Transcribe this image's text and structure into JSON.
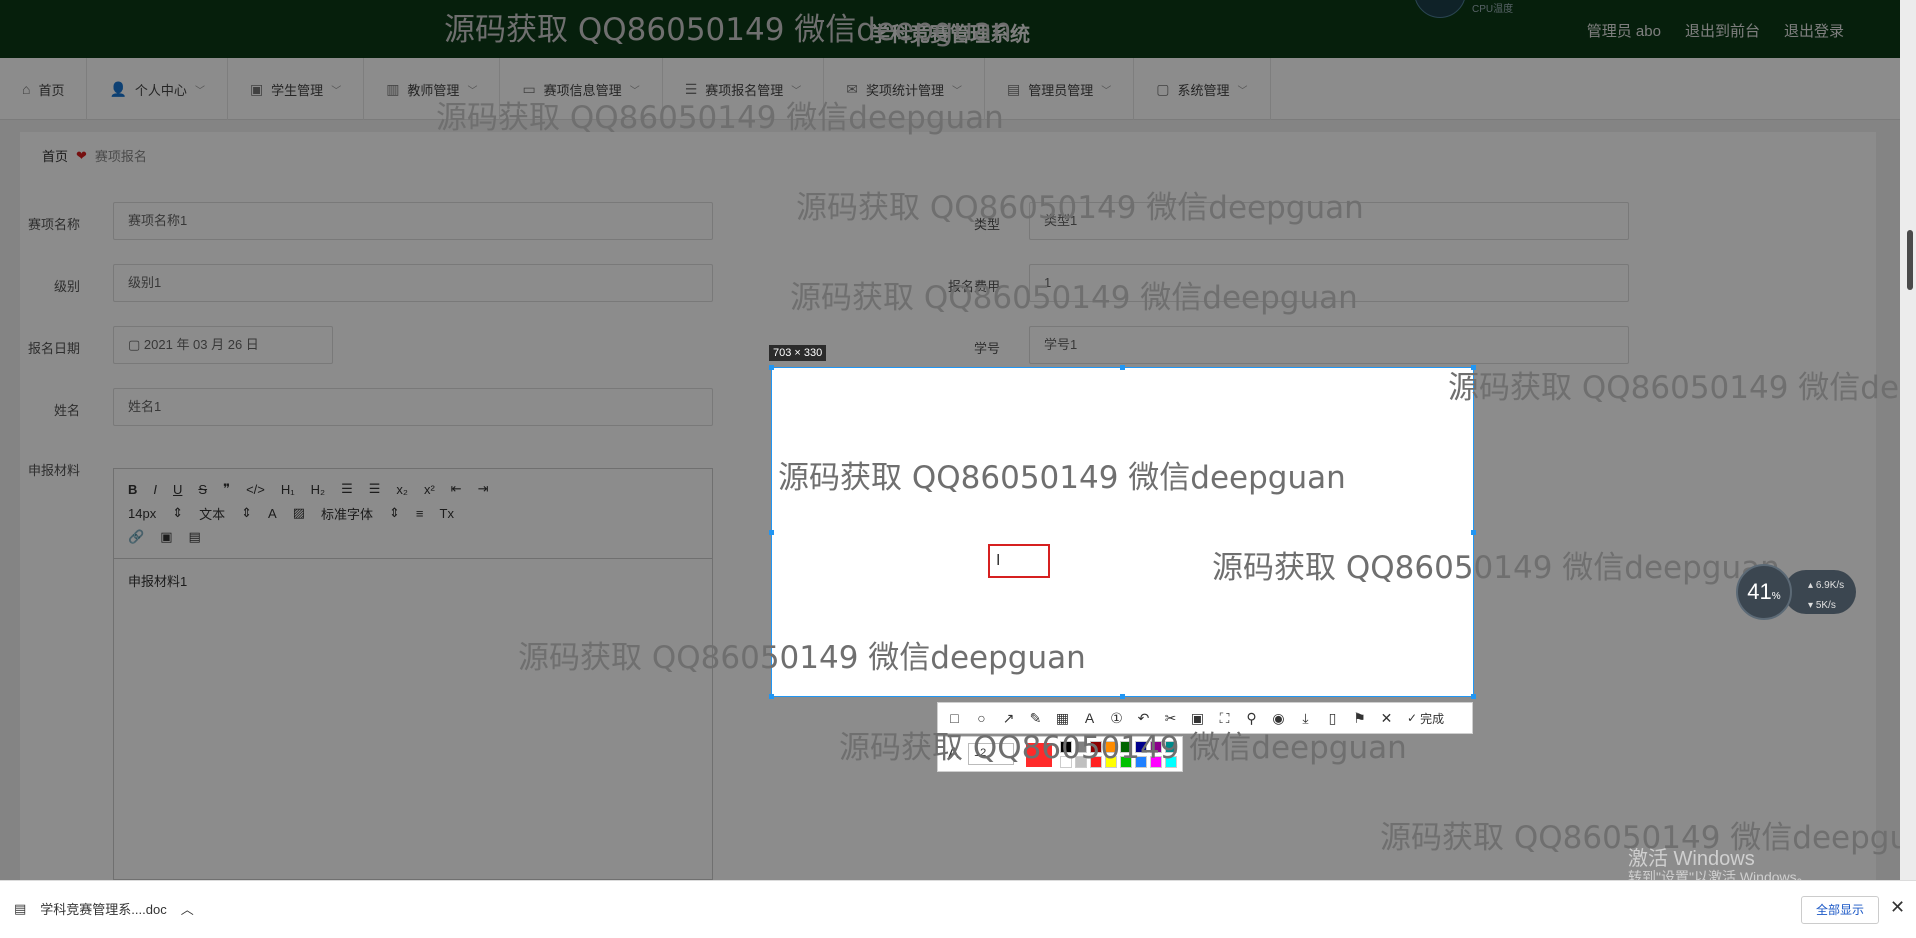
{
  "header": {
    "title": "学科竞赛管理系统",
    "admin": "管理员 abo",
    "front": "退出到前台",
    "logout": "退出登录",
    "cpu_label": "CPU温度"
  },
  "nav": [
    {
      "label": "首页",
      "icon": "home-icon",
      "glyph": "⌂",
      "arrow": ""
    },
    {
      "label": "个人中心",
      "icon": "user-icon",
      "glyph": "👤",
      "arrow": "﹀"
    },
    {
      "label": "学生管理",
      "icon": "student-icon",
      "glyph": "▣",
      "arrow": "﹀"
    },
    {
      "label": "教师管理",
      "icon": "teacher-icon",
      "glyph": "▥",
      "arrow": "﹀"
    },
    {
      "label": "赛项信息管理",
      "icon": "monitor-icon",
      "glyph": "▭",
      "arrow": "﹀"
    },
    {
      "label": "赛项报名管理",
      "icon": "list-icon",
      "glyph": "☰",
      "arrow": "﹀"
    },
    {
      "label": "奖项统计管理",
      "icon": "mail-icon",
      "glyph": "✉",
      "arrow": "﹀"
    },
    {
      "label": "管理员管理",
      "icon": "bars-icon",
      "glyph": "▤",
      "arrow": "﹀"
    },
    {
      "label": "系统管理",
      "icon": "chat-icon",
      "glyph": "▢",
      "arrow": "﹀"
    }
  ],
  "breadcrumb": {
    "home": "首页",
    "current": "赛项报名"
  },
  "form": {
    "name_label": "赛项名称",
    "name_value": "赛项名称1",
    "type_label": "类型",
    "type_value": "类型1",
    "level_label": "级别",
    "level_value": "级别1",
    "fee_label": "报名费用",
    "fee_value": "1",
    "date_label": "报名日期",
    "date_value": "2021 年 03 月 26 日",
    "sid_label": "学号",
    "sid_value": "学号1",
    "sname_label": "姓名",
    "sname_value": "姓名1",
    "material_label": "申报材料"
  },
  "editor": {
    "font_size": "14px",
    "text_type": "文本",
    "font_family": "标准字体",
    "content": "申报材料1"
  },
  "snip": {
    "size": "703 × 330",
    "done": "完成",
    "pen_size": "12"
  },
  "watermark": "源码获取 QQ86050149 微信deepguan",
  "speed": {
    "percent": "41",
    "up": "6.9",
    "down": "5",
    "unit": "K/s"
  },
  "activation": {
    "line1": "激活 Windows",
    "line2": "转到\"设置\"以激活 Windows。"
  },
  "download": {
    "file": "学科竞赛管理系....doc",
    "show_all": "全部显示"
  },
  "colors": {
    "header_bg": "#0b3a16",
    "pen_current": "#ff2a2a",
    "palette_top": [
      "#000000",
      "#808080",
      "#8b0000",
      "#ff8c00",
      "#006400",
      "#00008b",
      "#8b008b",
      "#008b8b"
    ],
    "palette_bottom": [
      "#ffffff",
      "#c0c0c0",
      "#ff2020",
      "#ffff00",
      "#00c000",
      "#2080ff",
      "#ff00ff",
      "#00ffff"
    ]
  }
}
